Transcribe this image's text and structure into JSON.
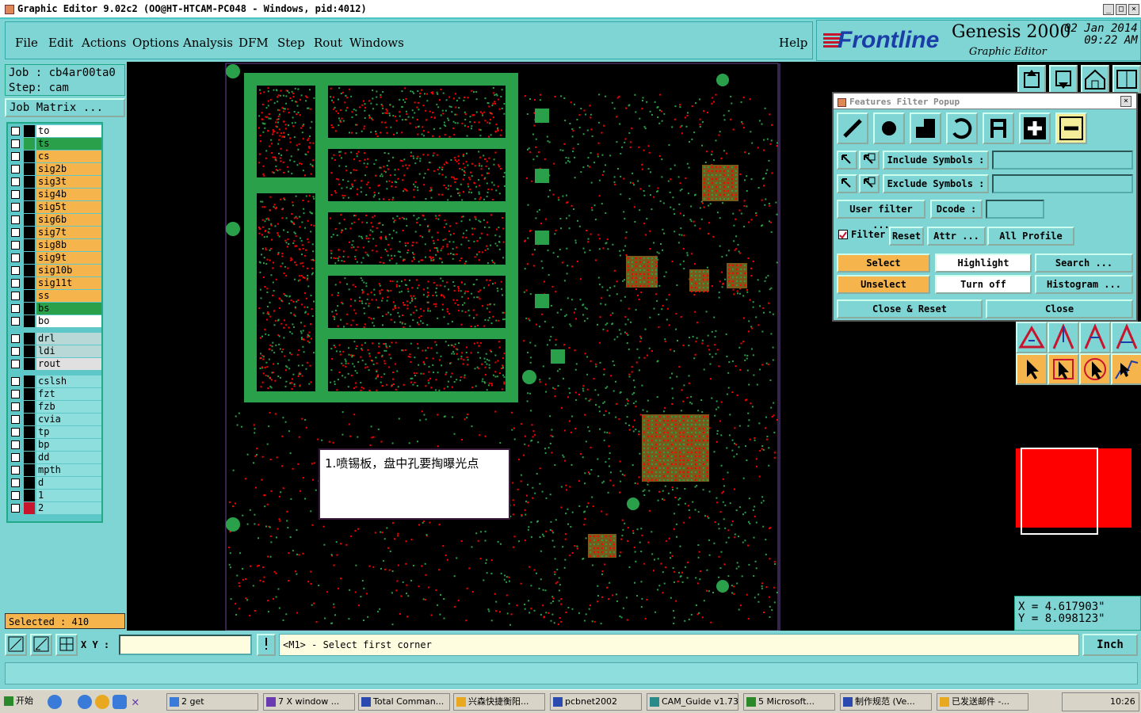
{
  "window": {
    "title": "Graphic Editor 9.02c2  (OO@HT-HTCAM-PC048 - Windows, pid:4012)",
    "btn_min": "_",
    "btn_max": "□",
    "btn_close": "×"
  },
  "menu": {
    "items": [
      "File",
      "Edit",
      "Actions",
      "Options",
      "Analysis",
      "DFM",
      "Step",
      "Rout",
      "Windows"
    ],
    "help": "Help"
  },
  "brand": {
    "logo": "Frontline",
    "product": "Genesis 2000",
    "sub": "Graphic Editor",
    "date": "02 Jan 2014",
    "time": "09:22 AM"
  },
  "left": {
    "job": "Job : cb4ar00ta0",
    "step": "Step: cam",
    "job_matrix": "Job Matrix ...",
    "selected": "Selected : 410",
    "layers": [
      {
        "name": "to",
        "color": "#ffffff",
        "sw": "#000000"
      },
      {
        "name": "ts",
        "color": "#2aa04a",
        "sw": "#2aa04a"
      },
      {
        "name": "cs",
        "color": "#f6b44d",
        "sw": "#000000"
      },
      {
        "name": "sig2b",
        "color": "#f6b44d",
        "sw": "#000000"
      },
      {
        "name": "sig3t",
        "color": "#f6b44d",
        "sw": "#000000"
      },
      {
        "name": "sig4b",
        "color": "#f6b44d",
        "sw": "#000000"
      },
      {
        "name": "sig5t",
        "color": "#f6b44d",
        "sw": "#000000"
      },
      {
        "name": "sig6b",
        "color": "#f6b44d",
        "sw": "#000000"
      },
      {
        "name": "sig7t",
        "color": "#f6b44d",
        "sw": "#000000"
      },
      {
        "name": "sig8b",
        "color": "#f6b44d",
        "sw": "#000000"
      },
      {
        "name": "sig9t",
        "color": "#f6b44d",
        "sw": "#000000"
      },
      {
        "name": "sig10b",
        "color": "#f6b44d",
        "sw": "#000000"
      },
      {
        "name": "sig11t",
        "color": "#f6b44d",
        "sw": "#000000"
      },
      {
        "name": "ss",
        "color": "#f6b44d",
        "sw": "#000000"
      },
      {
        "name": "bs",
        "color": "#2aa04a",
        "sw": "#000000"
      },
      {
        "name": "bo",
        "color": "#ffffff",
        "sw": "#000000"
      },
      {
        "name": "drl",
        "color": "#b8d8d8",
        "sw": "#000000"
      },
      {
        "name": "ldi",
        "color": "#b8d8d8",
        "sw": "#000000"
      },
      {
        "name": "rout",
        "color": "#e0e0e0",
        "sw": "#000000"
      },
      {
        "name": "cslsh",
        "color": "#8fdede",
        "sw": "#000000"
      },
      {
        "name": "fzt",
        "color": "#8fdede",
        "sw": "#000000"
      },
      {
        "name": "fzb",
        "color": "#8fdede",
        "sw": "#000000"
      },
      {
        "name": "cvia",
        "color": "#8fdede",
        "sw": "#000000"
      },
      {
        "name": "tp",
        "color": "#8fdede",
        "sw": "#000000"
      },
      {
        "name": "bp",
        "color": "#8fdede",
        "sw": "#000000"
      },
      {
        "name": "dd",
        "color": "#8fdede",
        "sw": "#000000"
      },
      {
        "name": "mpth",
        "color": "#8fdede",
        "sw": "#000000"
      },
      {
        "name": "d",
        "color": "#8fdede",
        "sw": "#000000"
      },
      {
        "name": "1",
        "color": "#8fdede",
        "sw": "#000000"
      },
      {
        "name": "2",
        "color": "#8fdede",
        "sw": "#c8142c"
      }
    ]
  },
  "popup": {
    "title": "Features Filter Popup",
    "include_symbols": "Include Symbols :",
    "exclude_symbols": "Exclude Symbols :",
    "user_filter": "User filter ...",
    "dcode": "Dcode :",
    "filter": "Filter",
    "reset": "Reset",
    "attr": "Attr ...",
    "all_profile": "All Profile",
    "select": "Select",
    "highlight": "Highlight",
    "search": "Search ...",
    "unselect": "Unselect",
    "turn_off": "Turn off",
    "histogram": "Histogram ...",
    "close_reset": "Close & Reset",
    "close": "Close"
  },
  "annotation": "1.喷锡板，盘中孔要掏曝光点",
  "coords": {
    "x": "X = 4.617903\"",
    "y": "Y = 8.098123\""
  },
  "cmd": {
    "xy_label": "X Y :",
    "xy_value": "",
    "prompt": "<M1> - Select first corner",
    "units": "Inch"
  },
  "taskbar": {
    "start": "开始",
    "items": [
      "2 get",
      "7 X window ...",
      "Total Comman...",
      "兴森快捷衡阳...",
      "pcbnet2002",
      "CAM_Guide v1.73",
      "5 Microsoft...",
      "制作规范 (Ve...",
      "已发送邮件 -..."
    ],
    "clock": "10:26"
  },
  "colors": {
    "accent": "#7fd4d4",
    "orange": "#f6b44d",
    "green": "#2aa04a",
    "red": "#ff0000"
  }
}
